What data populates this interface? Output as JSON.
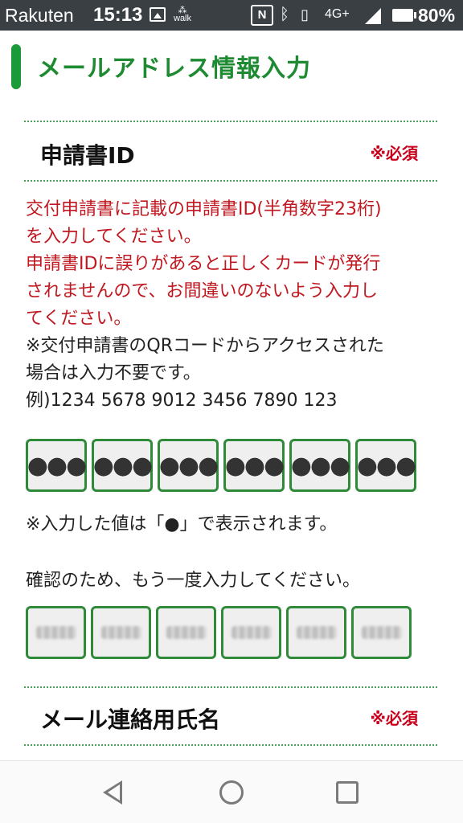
{
  "status_bar": {
    "carrier": "Rakuten",
    "time": "15:13",
    "walk_label": "walk",
    "nfc_label": "N",
    "network": "4G+",
    "battery": "80%"
  },
  "page": {
    "title": "メールアドレス情報入力"
  },
  "application_id": {
    "label": "申請書ID",
    "required": "※必須",
    "desc_red": [
      "交付申請書に記載の申請書ID(半角数字23桁)",
      "を入力してください。",
      "申請書IDに誤りがあると正しくカードが発行",
      "されませんので、お間違いのないよう入力し",
      "てください。"
    ],
    "desc_black": [
      "※交付申請書のQRコードからアクセスされた",
      "場合は入力不要です。",
      "例)1234 5678 9012 3456 7890 123"
    ],
    "input_values": [
      "●●●",
      "●●●",
      "●●●",
      "●●●",
      "●●●",
      "●●●"
    ],
    "masked_note": "※入力した値は「●」で表示されます。",
    "confirm_label": "確認のため、もう一度入力してください。"
  },
  "mail_name": {
    "label": "メール連絡用氏名",
    "required": "※必須"
  },
  "colors": {
    "accent_green": "#1e8a32",
    "required_red": "#c8001c"
  }
}
